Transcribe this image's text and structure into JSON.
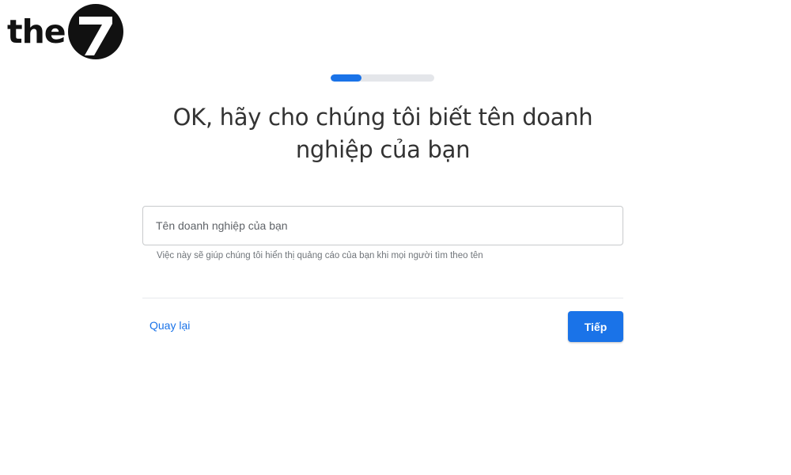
{
  "logo": {
    "text": "the",
    "badge_glyph": "7"
  },
  "progress": {
    "value": 0.3,
    "fill_color": "#1a73e8",
    "track_color": "#e4e6ea"
  },
  "headline": {
    "line1": "OK, hãy cho chúng tôi biết tên doanh",
    "line2": "nghiệp của bạn"
  },
  "business_name": {
    "placeholder": "Tên doanh nghiệp của bạn",
    "value": "",
    "hint": "Việc này sẽ giúp chúng tôi hiển thị quảng cáo của bạn khi mọi người tìm theo tên"
  },
  "actions": {
    "back_label": "Quay lại",
    "next_label": "Tiếp"
  },
  "colors": {
    "accent": "#1a73e8",
    "headline_text": "#333333",
    "hint_text": "#70757a"
  }
}
